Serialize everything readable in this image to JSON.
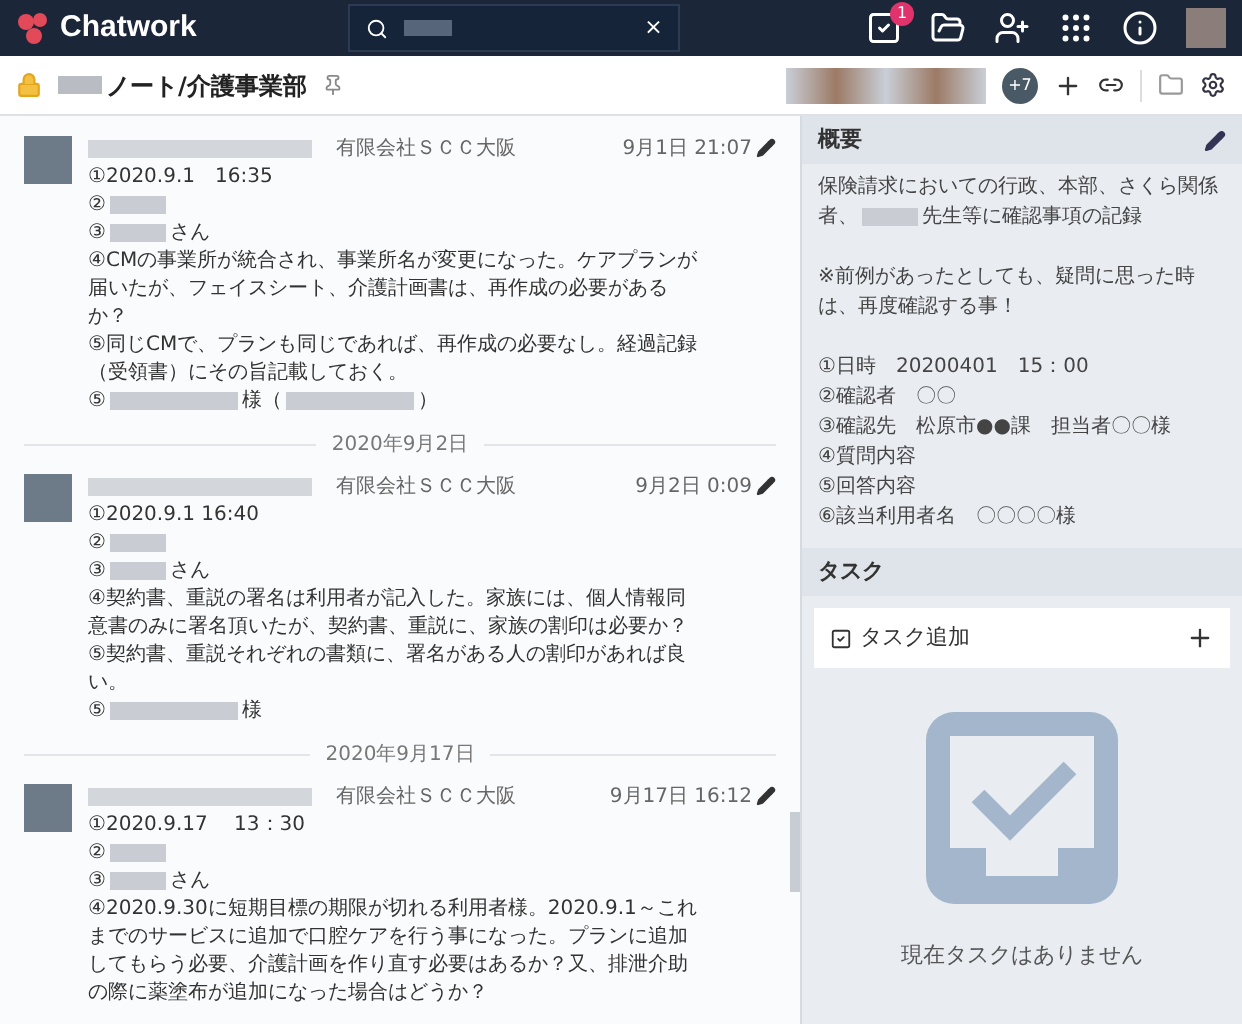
{
  "topbar": {
    "logo": "Chatwork",
    "search": {
      "clear": "×"
    },
    "task_badge": "1"
  },
  "room": {
    "name": "ノート/介護事業部",
    "more_members": "+7"
  },
  "messages": [
    {
      "org": "有限会社ＳＣＣ大阪",
      "time": "9月1日 21:07",
      "lines": [
        [
          {
            "kind": "text",
            "text": "①2020.9.1　16:35"
          }
        ],
        [
          {
            "kind": "text",
            "text": "②"
          },
          {
            "kind": "blur_short"
          }
        ],
        [
          {
            "kind": "text",
            "text": "③"
          },
          {
            "kind": "blur_short"
          },
          {
            "kind": "text",
            "text": "さん"
          }
        ],
        [
          {
            "kind": "text",
            "text": "④CMの事業所が統合され、事業所名が変更になった。ケアプランが届いたが、フェイスシート、介護計画書は、再作成の必要があるか？"
          }
        ],
        [
          {
            "kind": "text",
            "text": "⑤同じCMで、プランも同じであれば、再作成の必要なし。経過記録（受領書）にその旨記載しておく。"
          }
        ],
        [
          {
            "kind": "text",
            "text": "⑤"
          },
          {
            "kind": "blur_long"
          },
          {
            "kind": "text",
            "text": "様（"
          },
          {
            "kind": "blur_long"
          },
          {
            "kind": "text",
            "text": "）"
          }
        ]
      ]
    },
    {
      "divider": "2020年9月2日",
      "org": "有限会社ＳＣＣ大阪",
      "time": "9月2日 0:09",
      "lines": [
        [
          {
            "kind": "text",
            "text": "①2020.9.1 16:40"
          }
        ],
        [
          {
            "kind": "text",
            "text": "②"
          },
          {
            "kind": "blur_short"
          }
        ],
        [
          {
            "kind": "text",
            "text": "③"
          },
          {
            "kind": "blur_short"
          },
          {
            "kind": "text",
            "text": "さん"
          }
        ],
        [
          {
            "kind": "text",
            "text": "④契約書、重説の署名は利用者が記入した。家族には、個人情報同意書のみに署名頂いたが、契約書、重説に、家族の割印は必要か？"
          }
        ],
        [
          {
            "kind": "text",
            "text": "⑤契約書、重説それぞれの書類に、署名がある人の割印があれば良い。"
          }
        ],
        [
          {
            "kind": "text",
            "text": "⑤"
          },
          {
            "kind": "blur_long"
          },
          {
            "kind": "text",
            "text": "様"
          }
        ]
      ]
    },
    {
      "divider": "2020年9月17日",
      "org": "有限会社ＳＣＣ大阪",
      "time": "9月17日 16:12",
      "lines": [
        [
          {
            "kind": "text",
            "text": "①2020.9.17　 13：30"
          }
        ],
        [
          {
            "kind": "text",
            "text": "②"
          },
          {
            "kind": "blur_short"
          }
        ],
        [
          {
            "kind": "text",
            "text": "③"
          },
          {
            "kind": "blur_short"
          },
          {
            "kind": "text",
            "text": "さん"
          }
        ],
        [
          {
            "kind": "text",
            "text": "④2020.9.30に短期目標の期限が切れる利用者様。2020.9.1～これまでのサービスに追加で口腔ケアを行う事になった。プランに追加してもらう必要、介護計画を作り直す必要はあるか？又、排泄介助の際に薬塗布が追加になった場合はどうか？"
          }
        ]
      ]
    }
  ],
  "summary": {
    "title": "概要",
    "paragraphs": [
      [
        {
          "kind": "text",
          "text": "保険請求においての行政、本部、さくら関係"
        }
      ],
      [
        {
          "kind": "text",
          "text": "者、"
        },
        {
          "kind": "blur_short"
        },
        {
          "kind": "text",
          "text": "先生等に確認事項の記録"
        }
      ],
      [
        {
          "kind": "text",
          "text": "※前例があったとしても、疑問に思った時"
        }
      ],
      [
        {
          "kind": "text",
          "text": "は、再度確認する事！"
        }
      ],
      [
        {
          "kind": "text",
          "text": "①日時　20200401　15：00"
        }
      ],
      [
        {
          "kind": "text",
          "text": "②確認者　〇〇"
        }
      ],
      [
        {
          "kind": "text",
          "text": "③確認先　松原市●●課　担当者〇〇様"
        }
      ],
      [
        {
          "kind": "text",
          "text": "④質問内容"
        }
      ],
      [
        {
          "kind": "text",
          "text": "⑤回答内容"
        }
      ],
      [
        {
          "kind": "text",
          "text": "⑥該当利用者名　〇〇〇〇様"
        }
      ]
    ]
  },
  "tasks": {
    "title": "タスク",
    "add": "タスク追加",
    "empty": "現在タスクはありません"
  }
}
